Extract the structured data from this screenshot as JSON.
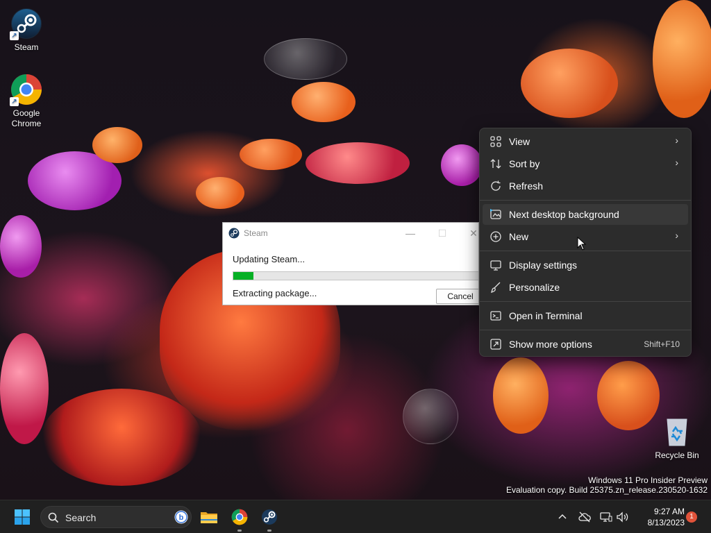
{
  "desktop": {
    "icons": [
      {
        "label": "Steam"
      },
      {
        "label": "Google Chrome"
      },
      {
        "label": "Recycle Bin"
      }
    ],
    "watermark": {
      "line1": "Windows 11 Pro Insider Preview",
      "line2": "Evaluation copy. Build 25375.zn_release.230520-1632"
    }
  },
  "steam_dialog": {
    "title": "Steam",
    "status": "Updating Steam...",
    "progress_fraction": 0.08,
    "substatus": "Extracting package...",
    "cancel_label": "Cancel",
    "progress_color": "#06b025"
  },
  "context_menu": {
    "items": [
      {
        "label": "View",
        "icon": "grid-icon",
        "submenu": true
      },
      {
        "label": "Sort by",
        "icon": "sort-icon",
        "submenu": true
      },
      {
        "label": "Refresh",
        "icon": "refresh-icon"
      },
      {
        "label": "Next desktop background",
        "icon": "next-background-icon"
      },
      {
        "label": "New",
        "icon": "plus-circle-icon",
        "submenu": true
      },
      {
        "label": "Display settings",
        "icon": "display-icon"
      },
      {
        "label": "Personalize",
        "icon": "brush-icon"
      },
      {
        "label": "Open in Terminal",
        "icon": "terminal-icon"
      },
      {
        "label": "Show more options",
        "icon": "more-options-icon",
        "shortcut": "Shift+F10"
      }
    ]
  },
  "taskbar": {
    "search_placeholder": "Search",
    "clock_time": "9:27 AM",
    "clock_date": "8/13/2023",
    "notification_count": "1",
    "pinned": [
      "file-explorer-icon",
      "chrome-icon",
      "steam-icon"
    ]
  },
  "colors": {
    "accent": "#0078d4",
    "menu_bg": "#2c2c2c",
    "taskbar_bg": "#202020",
    "badge": "#e0533a"
  }
}
